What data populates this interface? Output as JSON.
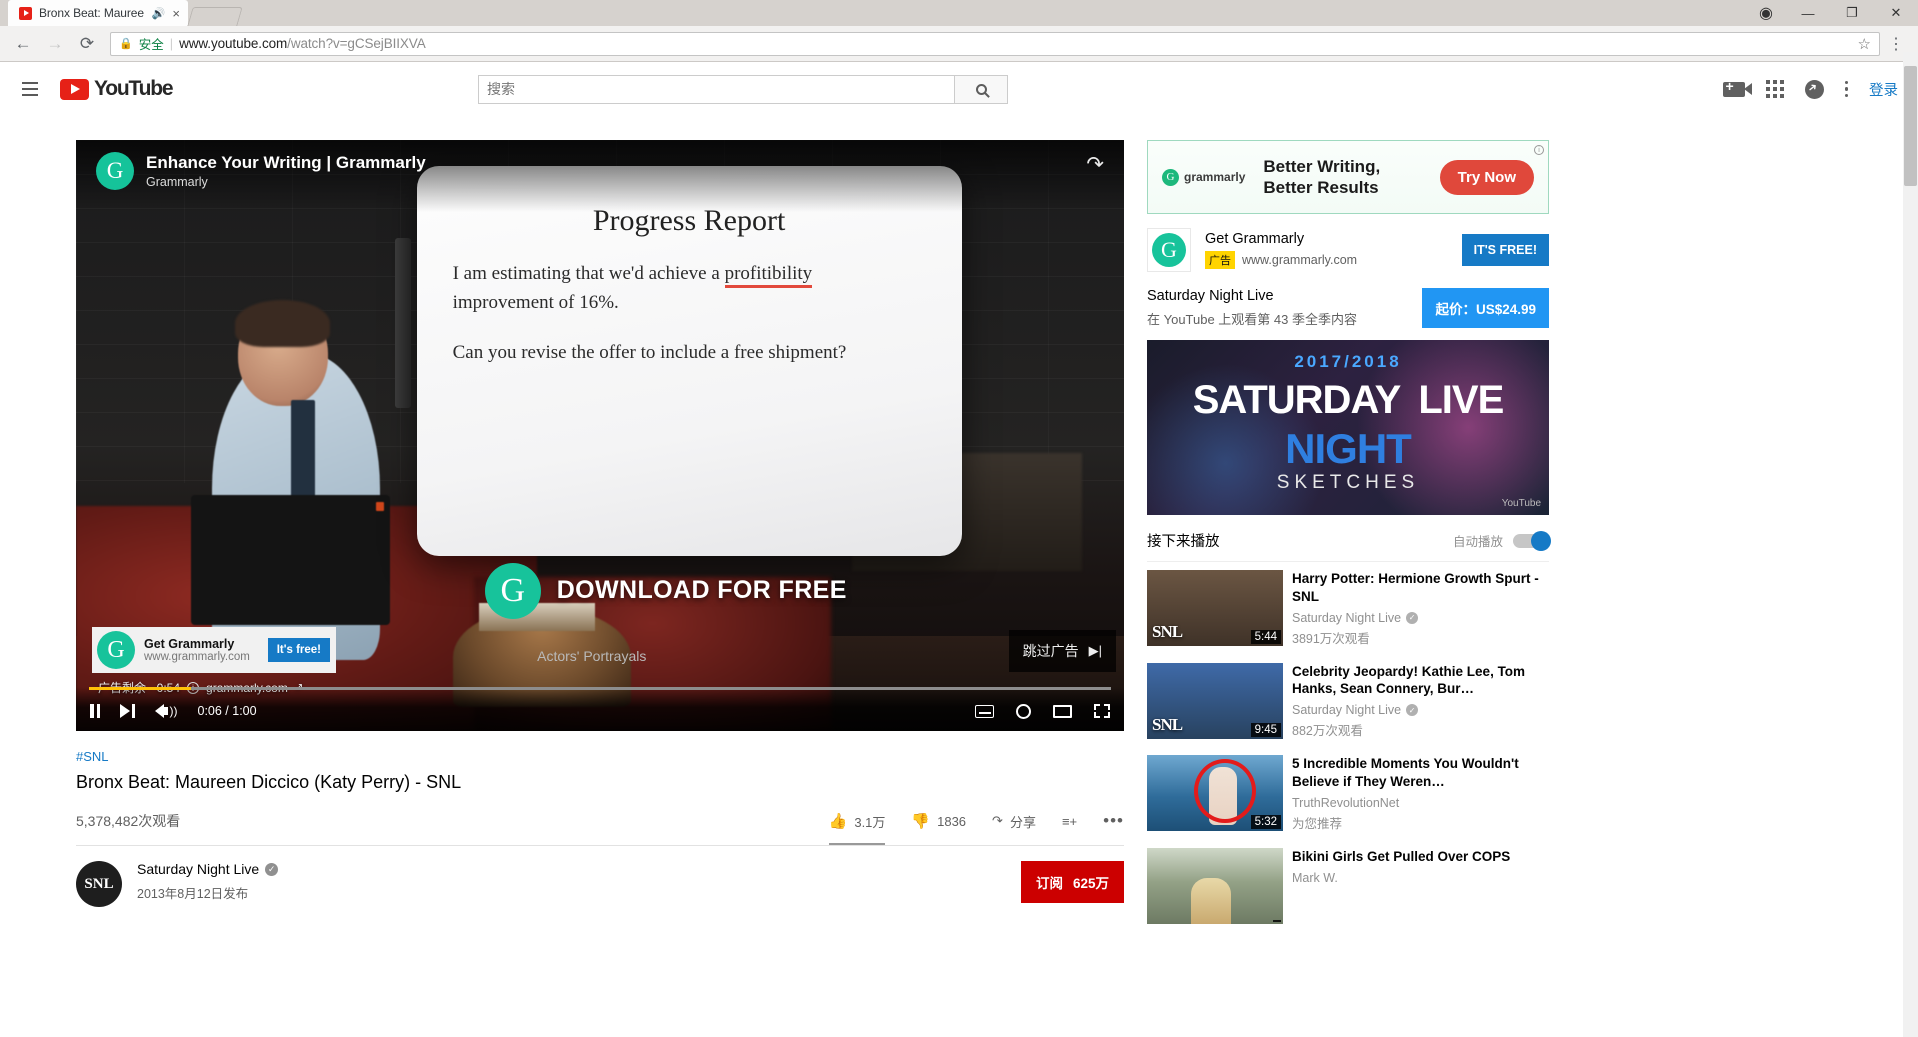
{
  "browser": {
    "tab_title": "Bronx Beat: Mauree",
    "secure_label": "安全",
    "url_scheme": "https://",
    "url_host": "www.youtube.com",
    "url_path": "/watch?v=gCSejBIIXVA",
    "audio_icon": "speaker-icon",
    "close_icon": "×",
    "back_icon": "←",
    "forward_icon": "→",
    "reload_icon": "⟳",
    "lock_icon": "🔒",
    "star_icon": "☆",
    "menu_icon": "⋮",
    "minimize": "—",
    "maximize": "❐",
    "win_close": "✕",
    "profile_icon": "◉"
  },
  "masthead": {
    "logo_text": "YouTube",
    "search_placeholder": "搜索",
    "search_value": "",
    "signin_label": "登录",
    "icons": [
      "upload-video-icon",
      "apps-grid-icon",
      "messages-icon",
      "more-vertical-icon"
    ]
  },
  "player": {
    "ad_video_title": "Enhance Your Writing | Grammarly",
    "ad_channel": "Grammarly",
    "share_icon": "↷",
    "whiteboard": {
      "title": "Progress Report",
      "line1_a": "I am estimating that we'd achieve a ",
      "line1_underlined": "profitibility",
      "line2": "improvement of 16%.",
      "line3": "Can you revise the offer to include a free shipment?"
    },
    "download_text": "DOWNLOAD FOR FREE",
    "actors_note": "Actors' Portrayals",
    "overlay_ad": {
      "title": "Get Grammarly",
      "url": "www.grammarly.com",
      "cta": "It's free!"
    },
    "ad_meta": {
      "remaining": "广告剩余 · 0:54",
      "info_icon": "i",
      "advertiser": "grammarly.com",
      "external_icon": "↗"
    },
    "skip_label": "跳过广告",
    "skip_icon": "▶|",
    "controls": {
      "pause_icon": "pause-icon",
      "next_icon": "next-video-icon",
      "volume_icon": "volume-icon",
      "time": "0:06 / 1:00",
      "cc_icon": "closed-captions-icon",
      "settings_icon": "settings-gear-icon",
      "theater_icon": "theater-mode-icon",
      "fullscreen_icon": "fullscreen-icon",
      "progress_percent": 10
    }
  },
  "video_meta": {
    "hashtag": "#SNL",
    "title": "Bronx Beat: Maureen Diccico (Katy Perry) - SNL",
    "views": "5,378,482次观看",
    "likes": "3.1万",
    "dislikes": "1836",
    "share_label": "分享",
    "save_icon": "add-to-playlist-icon",
    "more_icon": "•••",
    "like_icon": "thumb-up-icon",
    "dislike_icon": "thumb-down-icon",
    "share_icon": "share-arrow-icon"
  },
  "channel": {
    "avatar_text": "SNL",
    "name": "Saturday Night Live",
    "verified_icon": "✓",
    "published": "2013年8月12日发布",
    "subscribe_label": "订阅",
    "subscriber_count": "625万"
  },
  "sidebar": {
    "banner_ad": {
      "brand": "grammarly",
      "headline_line1": "Better Writing,",
      "headline_line2": "Better Results",
      "cta": "Try Now",
      "info_icon": "i"
    },
    "promo": {
      "title": "Get Grammarly",
      "ad_chip": "广告",
      "url": "www.grammarly.com",
      "cta": "IT'S FREE!"
    },
    "snl_offer": {
      "title": "Saturday Night Live",
      "subtitle": "在 YouTube 上观看第 43 季全季内容",
      "price_label": "起价：US$24.99",
      "banner": {
        "year": "2017/2018",
        "word1": "SATURDAY",
        "word2": "LIVE",
        "word3": "NIGHT",
        "word4": "SKETCHES",
        "yt_mark": "YouTube"
      }
    },
    "upnext": {
      "heading": "接下来播放",
      "autoplay_label": "自动播放",
      "autoplay_on": true
    },
    "videos": [
      {
        "title": "Harry Potter: Hermione Growth Spurt - SNL",
        "channel": "Saturday Night Live",
        "verified": true,
        "views": "3891万次观看",
        "duration": "5:44",
        "thumb_badge": "SNL",
        "thumb_class": "th-hp"
      },
      {
        "title": "Celebrity Jeopardy! Kathie Lee, Tom Hanks, Sean Connery, Bur…",
        "channel": "Saturday Night Live",
        "verified": true,
        "views": "882万次观看",
        "duration": "9:45",
        "thumb_badge": "SNL",
        "thumb_class": "th-cj"
      },
      {
        "title": "5 Incredible Moments You Wouldn't Believe if They Weren…",
        "channel": "TruthRevolutionNet",
        "verified": false,
        "views": "为您推荐",
        "duration": "5:32",
        "thumb_badge": "",
        "thumb_class": "th-bk"
      },
      {
        "title": "Bikini Girls Get Pulled Over COPS",
        "channel": "Mark W.",
        "verified": false,
        "views": "",
        "duration": "",
        "thumb_badge": "",
        "thumb_class": "th-cop"
      }
    ]
  }
}
